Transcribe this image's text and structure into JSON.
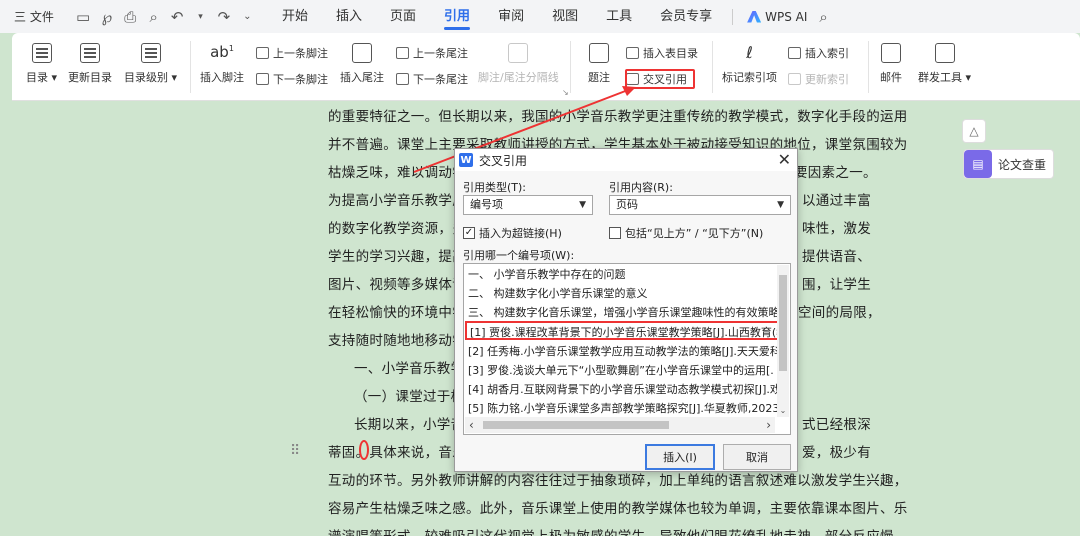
{
  "menubar": {
    "file": "三 文件",
    "tabs": [
      "开始",
      "插入",
      "页面",
      "引用",
      "审阅",
      "视图",
      "工具",
      "会员专享"
    ],
    "active_tab": "引用",
    "wps_ai": "WPS AI"
  },
  "ribbon": {
    "toc": "目录",
    "update_toc": "更新目录",
    "toc_level": "目录级别",
    "insert_footnote": "插入脚注",
    "prev_footnote": "上一条脚注",
    "next_footnote": "下一条脚注",
    "insert_endnote": "插入尾注",
    "prev_endnote": "上一条尾注",
    "next_endnote": "下一条尾注",
    "note_separator": "脚注/尾注分隔线",
    "caption": "题注",
    "insert_table_of_figures": "插入表目录",
    "cross_reference": "交叉引用",
    "mark_index_entry": "标记索引项",
    "insert_index": "插入索引",
    "update_index": "更新索引",
    "mail": "邮件",
    "mail_merge": "群发工具"
  },
  "document": {
    "lines": [
      "的重要特征之一。但长期以来，我国的小学音乐教学更注重传统的教学模式，数字化手段的运用",
      "并不普遍。课堂上主要采取教师讲授的方式，学生基本处于被动接受知识的地位，课堂氛围较为",
      "枯燥乏味，难以调动学生",
      "为提高小学音乐教学质",
      "的数字化教学资源，多",
      "学生的学习兴趣，提高",
      "图片、视频等多媒体课",
      "在轻松愉快的环境中学",
      "支持随时随地地移动学",
      "一、小学音乐教学",
      "（一）课堂过于枯",
      "长期以来，小学音",
      "蒂固。具体来说，音乐",
      "互动的环节。另外教师讲解的内容往往过于抽象琐碎，加上单纯的语言叙述难以激发学生兴趣，",
      "容易产生枯燥乏味之感。此外，音乐课堂上使用的教学媒体也较为单调，主要依靠课本图片、乐",
      "谱演唱等形式，较难吸引这代视觉上极为敏感的学生，导致他们眼花缭乱地走神，部分反应慢"
    ],
    "right_fragments": [
      "要因素之一。",
      "以通过丰富",
      "味性，激发",
      "提供语音、",
      "围，让学生",
      "空间的局限，",
      "式已经根深",
      "爱，极少有"
    ]
  },
  "side": {
    "paper_check": "论文查重"
  },
  "dialog": {
    "title": "交叉引用",
    "ref_type_label": "引用类型(T):",
    "ref_type_value": "编号项",
    "ref_content_label": "引用内容(R):",
    "ref_content_value": "页码",
    "hyperlink_label": "插入为超链接(H)",
    "hyperlink_checked": true,
    "above_below_label": "包括“见上方” / “见下方”(N)",
    "above_below_checked": false,
    "which_item_label": "引用哪一个编号项(W):",
    "items": [
      "一、 小学音乐教学中存在的问题",
      "二、 构建数字化小学音乐课堂的意义",
      "三、 构建数字化音乐课堂，增强小学音乐课堂趣味性的有效策略",
      "[1] 贾俊.课程改革背景下的小学音乐课堂教学策略[J].山西教育(教",
      "[2] 任秀梅.小学音乐课堂教学应用互动教学法的策略[J].天天爱科",
      "[3] 罗俊.浅谈大单元下“小型歌舞剧”在小学音乐课堂中的运用[.",
      "[4] 胡香月.互联网背景下的小学音乐课堂动态教学模式初探[J].戏",
      "[5] 陈力铭.小学音乐课堂多声部教学策略探究[J].华夏教师,2023(3"
    ],
    "selected_index": 3,
    "insert_button": "插入(I)",
    "cancel_button": "取消"
  }
}
